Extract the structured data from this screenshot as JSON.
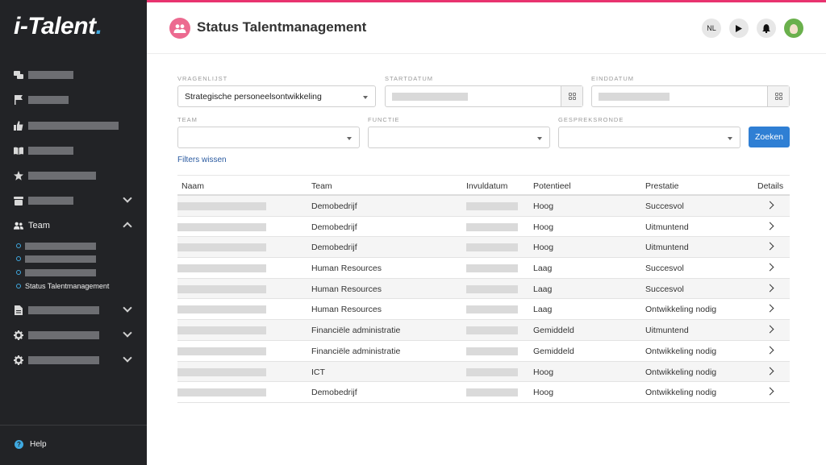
{
  "app": {
    "logo_main": "i-Talent",
    "logo_dot": ".",
    "accent": "#e8336f",
    "link_blue": "#3fa9e0"
  },
  "sidebar": {
    "items": [
      {
        "icon": "chat-icon"
      },
      {
        "icon": "flag-icon"
      },
      {
        "icon": "thumbs-up-icon"
      },
      {
        "icon": "book-icon"
      },
      {
        "icon": "star-icon"
      },
      {
        "icon": "drawer-icon",
        "expandable": true
      },
      {
        "icon": "team-icon",
        "label": "Team",
        "expanded": true
      },
      {
        "icon": "document-icon",
        "expandable": true
      },
      {
        "icon": "gear-icon",
        "expandable": true
      },
      {
        "icon": "gear-icon",
        "expandable": true
      }
    ],
    "team_subitems": [
      {
        "label": ""
      },
      {
        "label": ""
      },
      {
        "label": ""
      },
      {
        "label": "Status Talentmanagement",
        "active": true
      }
    ],
    "help_label": "Help"
  },
  "header": {
    "title": "Status Talentmanagement",
    "icon": "people-icon",
    "language": "NL"
  },
  "filters": {
    "vragenlijst_label": "VRAGENLIJST",
    "vragenlijst_value": "Strategische personeelsontwikkeling",
    "startdatum_label": "STARTDATUM",
    "einddatum_label": "EINDDATUM",
    "team_label": "TEAM",
    "functie_label": "FUNCTIE",
    "gespreksronde_label": "GESPREKSRONDE",
    "search_button": "Zoeken",
    "clear_link": "Filters wissen"
  },
  "table": {
    "columns": [
      "Naam",
      "Team",
      "Invuldatum",
      "Potentieel",
      "Prestatie",
      "Details"
    ],
    "rows": [
      {
        "team": "Demobedrijf",
        "potentieel": "Hoog",
        "prestatie": "Succesvol"
      },
      {
        "team": "Demobedrijf",
        "potentieel": "Hoog",
        "prestatie": "Uitmuntend"
      },
      {
        "team": "Demobedrijf",
        "potentieel": "Hoog",
        "prestatie": "Uitmuntend"
      },
      {
        "team": "Human Resources",
        "potentieel": "Laag",
        "prestatie": "Succesvol"
      },
      {
        "team": "Human Resources",
        "potentieel": "Laag",
        "prestatie": "Succesvol"
      },
      {
        "team": "Human Resources",
        "potentieel": "Laag",
        "prestatie": "Ontwikkeling nodig"
      },
      {
        "team": "Financiële administratie",
        "potentieel": "Gemiddeld",
        "prestatie": "Uitmuntend"
      },
      {
        "team": "Financiële administratie",
        "potentieel": "Gemiddeld",
        "prestatie": "Ontwikkeling nodig"
      },
      {
        "team": "ICT",
        "potentieel": "Hoog",
        "prestatie": "Ontwikkeling nodig"
      },
      {
        "team": "Demobedrijf",
        "potentieel": "Hoog",
        "prestatie": "Ontwikkeling nodig"
      }
    ]
  }
}
